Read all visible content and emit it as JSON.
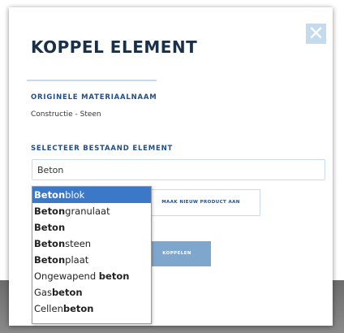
{
  "dialog": {
    "title": "KOPPEL ELEMENT",
    "close_glyph": "✕"
  },
  "original_material": {
    "label": "ORIGINELE MATERIAALNAAM",
    "value": "Constructie - Steen"
  },
  "select_element": {
    "label": "SELECTEER BESTAAND ELEMENT",
    "input_value": "Beton"
  },
  "buttons": {
    "new_product": "MAAK NIEUW PRODUCT AAN",
    "link": "KOPPELEN"
  },
  "dropdown": {
    "selected_index": 0,
    "items": [
      {
        "before": "",
        "match": "Beton",
        "after": "blok"
      },
      {
        "before": "",
        "match": "Beton",
        "after": "granulaat"
      },
      {
        "before": "",
        "match": "Beton",
        "after": ""
      },
      {
        "before": "",
        "match": "Beton",
        "after": "steen"
      },
      {
        "before": "",
        "match": "Beton",
        "after": "plaat"
      },
      {
        "before": "Ongewapend ",
        "match": "beton",
        "after": ""
      },
      {
        "before": "Gas",
        "match": "beton",
        "after": ""
      },
      {
        "before": "Cellen",
        "match": "beton",
        "after": ""
      }
    ]
  },
  "colors": {
    "title": "#1a2f48",
    "label": "#1f4e8c",
    "accent": "#3c78c8",
    "button": "#7fa6cc",
    "close_bg": "#c4dbee"
  }
}
